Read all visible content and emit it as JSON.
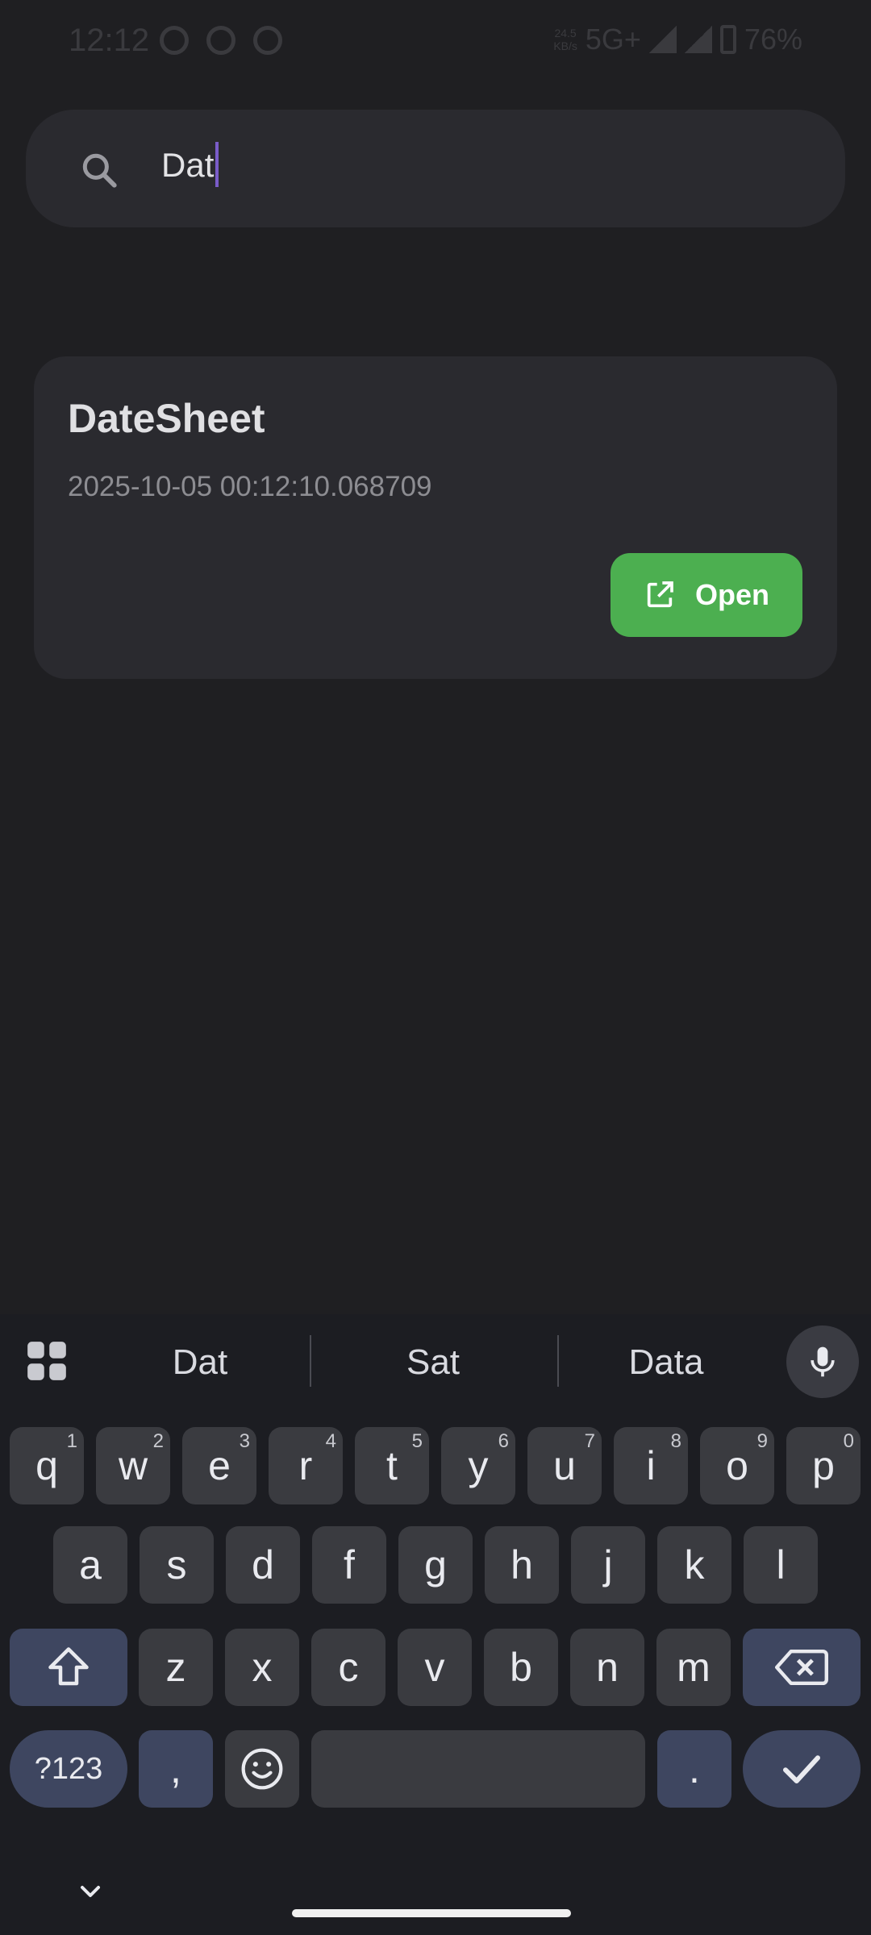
{
  "status_bar": {
    "time": "12:12",
    "speed_value": "24.5",
    "speed_unit": "KB/s",
    "network": "5G+",
    "battery": "76%"
  },
  "search": {
    "value": "Dat",
    "icon": "search-icon"
  },
  "results": [
    {
      "title": "DateSheet",
      "timestamp": "2025-10-05 00:12:10.068709",
      "open_label": "Open"
    }
  ],
  "keyboard": {
    "suggestions": [
      "Dat",
      "Sat",
      "Data"
    ],
    "row1": [
      {
        "k": "q",
        "h": "1"
      },
      {
        "k": "w",
        "h": "2"
      },
      {
        "k": "e",
        "h": "3"
      },
      {
        "k": "r",
        "h": "4"
      },
      {
        "k": "t",
        "h": "5"
      },
      {
        "k": "y",
        "h": "6"
      },
      {
        "k": "u",
        "h": "7"
      },
      {
        "k": "i",
        "h": "8"
      },
      {
        "k": "o",
        "h": "9"
      },
      {
        "k": "p",
        "h": "0"
      }
    ],
    "row2": [
      "a",
      "s",
      "d",
      "f",
      "g",
      "h",
      "j",
      "k",
      "l"
    ],
    "row3": [
      "z",
      "x",
      "c",
      "v",
      "b",
      "n",
      "m"
    ],
    "symbols_label": "?123",
    "comma_label": ",",
    "period_label": "."
  },
  "colors": {
    "accent_green": "#4caf50",
    "caret": "#7a5cc9",
    "background": "#1f1f22",
    "card": "#2a2a2f"
  }
}
